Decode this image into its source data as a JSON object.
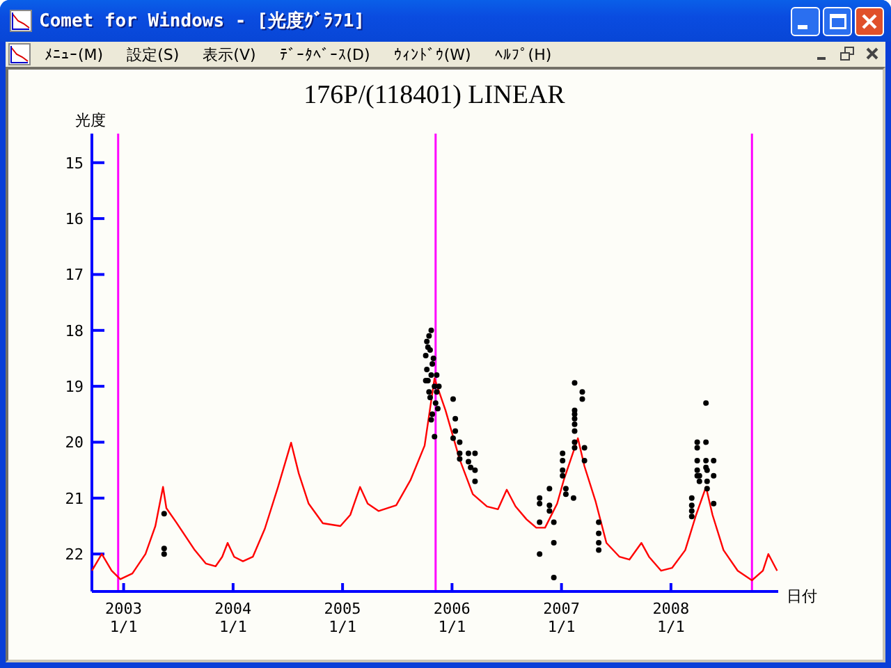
{
  "window": {
    "title": "Comet for Windows - [光度ｸﾞﾗﾌ1]"
  },
  "menu": [
    {
      "label": "ﾒﾆｭｰ(M)"
    },
    {
      "label": "設定(S)"
    },
    {
      "label": "表示(V)"
    },
    {
      "label": "ﾃﾞｰﾀﾍﾞｰｽ(D)"
    },
    {
      "label": "ｳｨﾝﾄﾞｳ(W)"
    },
    {
      "label": "ﾍﾙﾌﾟ(H)"
    }
  ],
  "graph": {
    "x_tick_dates": [
      "1/1",
      "1/1",
      "1/1",
      "1/1",
      "1/1",
      "1/1"
    ],
    "chart_data": {
      "type": "scatter",
      "title": "176P/(118401) LINEAR",
      "xlabel": "日付",
      "ylabel": "光度",
      "xlim": [
        2002.71,
        2008.98
      ],
      "ylim": [
        22.67,
        14.48
      ],
      "yticks": [
        15,
        16,
        17,
        18,
        19,
        20,
        21,
        22
      ],
      "xticks": [
        2003,
        2004,
        2005,
        2006,
        2007,
        2008
      ],
      "ref_lines": [
        {
          "axis": "x",
          "value": 2002.95
        },
        {
          "axis": "x",
          "value": 2005.85
        },
        {
          "axis": "x",
          "value": 2008.74
        }
      ],
      "series": [
        {
          "type": "line",
          "color": "#ff0000",
          "x": [
            2002.71,
            2002.8,
            2002.89,
            2002.97,
            2003.08,
            2003.2,
            2003.29,
            2003.36,
            2003.39,
            2003.48,
            2003.65,
            2003.75,
            2003.84,
            2003.9,
            2003.95,
            2004.01,
            2004.09,
            2004.18,
            2004.29,
            2004.41,
            2004.53,
            2004.6,
            2004.69,
            2004.82,
            2004.98,
            2005.07,
            2005.16,
            2005.23,
            2005.33,
            2005.49,
            2005.62,
            2005.75,
            2005.84,
            2005.94,
            2006.07,
            2006.19,
            2006.32,
            2006.42,
            2006.5,
            2006.58,
            2006.68,
            2006.77,
            2006.85,
            2006.96,
            2007.02,
            2007.15,
            2007.21,
            2007.31,
            2007.41,
            2007.53,
            2007.62,
            2007.73,
            2007.8,
            2007.91,
            2008.01,
            2008.13,
            2008.23,
            2008.32,
            2008.38,
            2008.48,
            2008.61,
            2008.74,
            2008.84,
            2008.89,
            2008.97
          ],
          "values": [
            22.3,
            22.0,
            22.3,
            22.45,
            22.35,
            22.0,
            21.5,
            20.8,
            21.18,
            21.43,
            21.93,
            22.17,
            22.22,
            22.05,
            21.8,
            22.05,
            22.13,
            22.05,
            21.55,
            20.8,
            20.01,
            20.56,
            21.1,
            21.45,
            21.5,
            21.3,
            20.8,
            21.1,
            21.23,
            21.13,
            20.68,
            20.06,
            18.86,
            19.43,
            20.31,
            20.93,
            21.15,
            21.2,
            20.85,
            21.15,
            21.38,
            21.53,
            21.53,
            21.1,
            20.68,
            19.93,
            20.43,
            21.05,
            21.8,
            22.05,
            22.1,
            21.8,
            22.05,
            22.3,
            22.25,
            21.93,
            21.3,
            20.8,
            21.3,
            21.93,
            22.3,
            22.47,
            22.3,
            22.0,
            22.3
          ]
        },
        {
          "type": "scatter",
          "color": "#000000",
          "x": [
            2003.37,
            2003.37,
            2003.37,
            2005.76,
            2005.77,
            2005.78,
            2005.79,
            2005.8,
            2005.81,
            2005.77,
            2005.78,
            2005.79,
            2005.8,
            2005.81,
            2005.82,
            2005.83,
            2005.84,
            2005.85,
            2005.86,
            2005.86,
            2005.87,
            2005.88,
            2005.82,
            2005.84,
            2005.76,
            2005.81,
            2006.01,
            2006.03,
            2006.03,
            2006.01,
            2006.07,
            2006.07,
            2006.07,
            2006.15,
            2006.15,
            2006.17,
            2006.21,
            2006.21,
            2006.21,
            2006.8,
            2006.8,
            2006.8,
            2006.8,
            2006.89,
            2006.89,
            2006.89,
            2006.93,
            2006.93,
            2006.93,
            2007.01,
            2007.01,
            2007.01,
            2007.01,
            2007.04,
            2007.04,
            2007.11,
            2007.12,
            2007.12,
            2007.12,
            2007.12,
            2007.12,
            2007.12,
            2007.12,
            2007.12,
            2007.19,
            2007.19,
            2007.21,
            2007.21,
            2007.34,
            2007.34,
            2007.34,
            2007.34,
            2008.19,
            2008.19,
            2008.19,
            2008.19,
            2008.24,
            2008.24,
            2008.24,
            2008.24,
            2008.24,
            2008.26,
            2008.26,
            2008.32,
            2008.32,
            2008.32,
            2008.32,
            2008.33,
            2008.33,
            2008.33,
            2008.39,
            2008.39,
            2008.39
          ],
          "values": [
            21.28,
            21.9,
            22.0,
            18.45,
            18.2,
            18.3,
            18.1,
            18.35,
            18.0,
            18.7,
            18.9,
            19.1,
            19.2,
            18.8,
            18.6,
            18.5,
            19.0,
            19.3,
            18.8,
            19.1,
            19.4,
            19.0,
            19.5,
            19.9,
            18.9,
            19.6,
            19.23,
            19.58,
            19.8,
            19.93,
            20.0,
            20.2,
            20.3,
            20.2,
            20.35,
            20.45,
            20.2,
            20.5,
            20.7,
            21.0,
            21.1,
            21.43,
            22.0,
            20.83,
            21.13,
            21.23,
            21.43,
            21.8,
            22.42,
            20.2,
            20.33,
            20.5,
            20.6,
            20.83,
            20.93,
            21.0,
            18.94,
            19.43,
            19.5,
            19.58,
            19.68,
            19.8,
            20.0,
            20.1,
            19.1,
            19.23,
            20.1,
            20.33,
            21.43,
            21.63,
            21.8,
            21.93,
            21.0,
            21.13,
            21.23,
            21.33,
            20.0,
            20.1,
            20.33,
            20.5,
            20.6,
            20.6,
            20.7,
            19.3,
            20.0,
            20.33,
            20.45,
            20.5,
            20.7,
            20.83,
            20.33,
            20.6,
            21.1
          ]
        }
      ]
    }
  }
}
